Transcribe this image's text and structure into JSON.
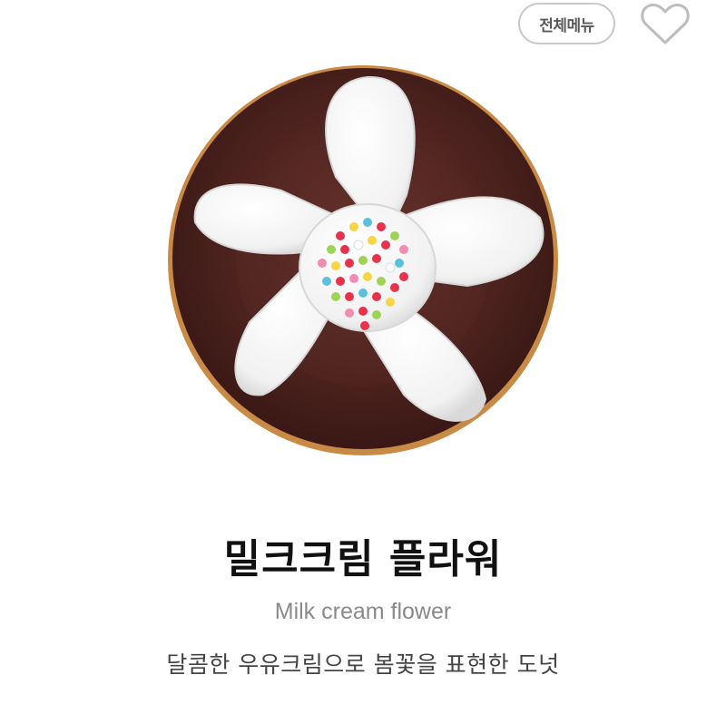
{
  "header": {
    "menu_label": "전체메뉴",
    "favorite_icon": "heart-outline-icon"
  },
  "product": {
    "image_alt": "donut-product-image",
    "name_ko": "밀크크림 플라워",
    "name_en": "Milk cream flower",
    "description": "달콤한 우유크림으로 봄꽃을 표현한 도넛"
  }
}
